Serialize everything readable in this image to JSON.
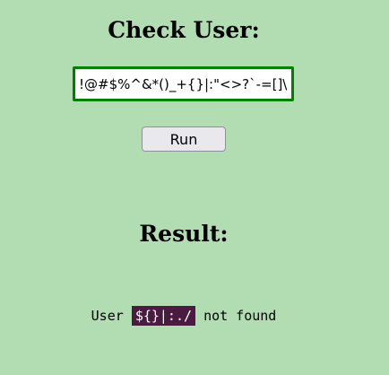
{
  "header": {
    "title": "Check User:"
  },
  "form": {
    "user_input_value": "!@#$%^&*()_+{}|:\"<>?`-=[]\\;',./",
    "run_label": "Run"
  },
  "result": {
    "title": "Result:",
    "prefix": "User",
    "username": "${}|:./",
    "suffix": "not found"
  },
  "colors": {
    "background": "#b2dcb2",
    "input_border": "#008000",
    "code_background": "#4a1a40"
  }
}
